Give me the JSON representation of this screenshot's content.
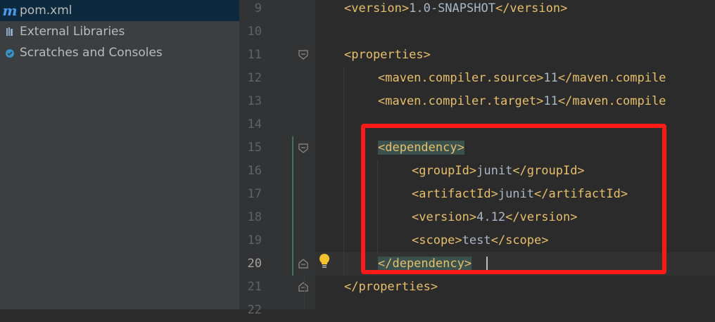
{
  "project_tree": {
    "items": [
      {
        "label": "pom.xml",
        "icon": "maven-m-icon",
        "selected": true
      },
      {
        "label": "External Libraries",
        "icon": "library-icon",
        "selected": false
      },
      {
        "label": "Scratches and Consoles",
        "icon": "scratches-icon",
        "selected": false
      }
    ]
  },
  "editor": {
    "current_line": "20",
    "lines": [
      {
        "no": "9",
        "tag_open": "<version>",
        "text": "1.0-SNAPSHOT",
        "tag_close": "</version>"
      },
      {
        "no": "10"
      },
      {
        "no": "11",
        "tag_open": "<properties>"
      },
      {
        "no": "12",
        "tag_open": "<maven.compiler.source>",
        "text": "11",
        "tag_close": "</maven.compile"
      },
      {
        "no": "13",
        "tag_open": "<maven.compiler.target>",
        "text": "11",
        "tag_close": "</maven.compile"
      },
      {
        "no": "14"
      },
      {
        "no": "15",
        "tag_open": "dependency"
      },
      {
        "no": "16",
        "tag_open": "<groupId>",
        "text": "junit",
        "tag_close": "</groupId>"
      },
      {
        "no": "17",
        "tag_open": "<artifactId>",
        "text": "junit",
        "tag_close": "</artifactId>"
      },
      {
        "no": "18",
        "tag_open": "<version>",
        "text": "4.12",
        "tag_close": "</version>"
      },
      {
        "no": "19",
        "tag_open": "<scope>",
        "text": "test",
        "tag_close": "</scope>"
      },
      {
        "no": "20",
        "tag_open": "</dependency"
      },
      {
        "no": "21",
        "tag_open": "</properties>"
      },
      {
        "no": "22"
      }
    ]
  },
  "colors": {
    "annotation_box": "#ff1a1a",
    "tag": "#e8bf6a",
    "text": "#a9b7c6",
    "brace_match": "#3b514d"
  }
}
